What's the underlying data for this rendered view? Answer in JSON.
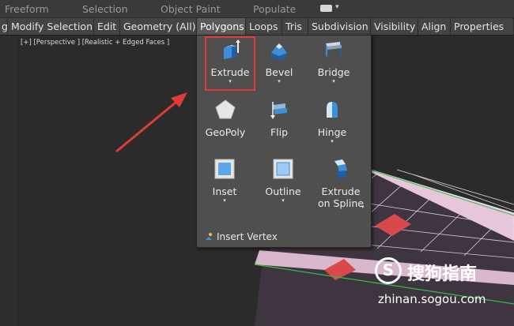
{
  "topbar": {
    "items": [
      "Freeform",
      "Selection",
      "Object Paint",
      "Populate"
    ]
  },
  "menubar": {
    "tabs": [
      {
        "label": "g"
      },
      {
        "label": "Modify Selection"
      },
      {
        "label": "Edit"
      },
      {
        "label": "Geometry (All)"
      },
      {
        "label": "Polygons"
      },
      {
        "label": "Loops"
      },
      {
        "label": "Tris"
      },
      {
        "label": "Subdivision"
      },
      {
        "label": "Visibility"
      },
      {
        "label": "Align"
      },
      {
        "label": "Properties"
      }
    ],
    "active": "Polygons"
  },
  "viewport": {
    "label": "[+] [Perspective ] [Realistic + Edged Faces ]"
  },
  "polygons_panel": {
    "tools": [
      {
        "label": "Extrude",
        "icon": "extrude-icon",
        "has_dropdown": true
      },
      {
        "label": "Bevel",
        "icon": "bevel-icon",
        "has_dropdown": true
      },
      {
        "label": "Bridge",
        "icon": "bridge-icon",
        "has_dropdown": true
      },
      {
        "label": "GeoPoly",
        "icon": "geopoly-icon",
        "has_dropdown": false
      },
      {
        "label": "Flip",
        "icon": "flip-icon",
        "has_dropdown": false
      },
      {
        "label": "Hinge",
        "icon": "hinge-icon",
        "has_dropdown": true
      },
      {
        "label": "Inset",
        "icon": "inset-icon",
        "has_dropdown": true
      },
      {
        "label": "Outline",
        "icon": "outline-icon",
        "has_dropdown": true
      },
      {
        "label": "Extrude\non Spline",
        "label_line1": "Extrude",
        "label_line2": "on Spline",
        "icon": "extrude-on-spline-icon",
        "has_dropdown": true
      }
    ],
    "insert_vertex": "Insert Vertex"
  },
  "watermark": {
    "logo_letter": "S",
    "text": "搜狗指南",
    "url": "zhinan.sogou.com"
  },
  "colors": {
    "highlight_box": "#e23a3a",
    "arrow": "#e23a3a",
    "mesh_pink": "#e7c6dc",
    "mesh_dark": "#3f3540",
    "selected_face": "#d9484b",
    "edge_green": "#2fbf4a"
  }
}
